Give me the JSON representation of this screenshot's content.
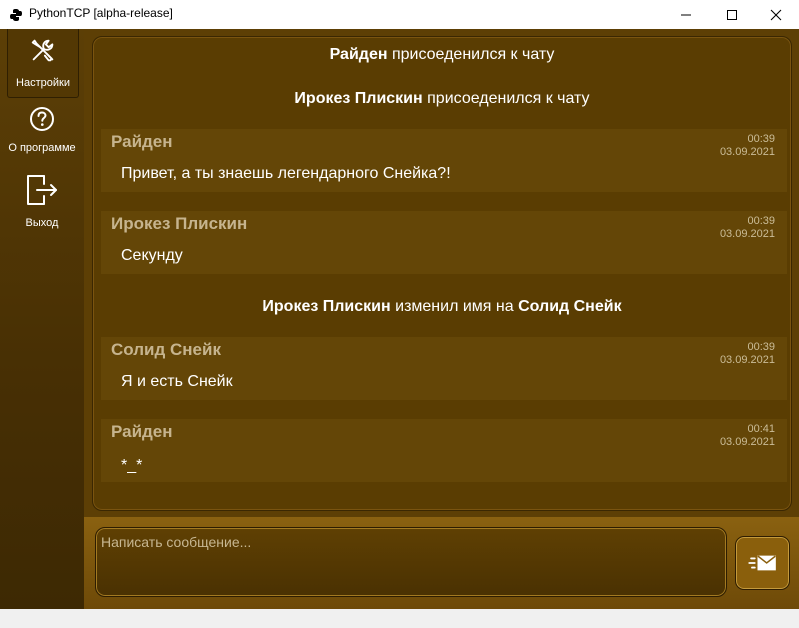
{
  "window": {
    "title": "PythonTCP [alpha-release]",
    "app_icon": "python-icon",
    "controls": [
      "minimize-icon",
      "maximize-icon",
      "close-icon"
    ]
  },
  "sidebar": {
    "items": [
      {
        "label": "Настройки",
        "icon": "wrench-screwdriver-icon",
        "active": true
      },
      {
        "label": "О программе",
        "icon": "question-circle-icon",
        "active": false
      },
      {
        "label": "Выход",
        "icon": "logout-icon",
        "active": false
      }
    ]
  },
  "chat": {
    "events": [
      {
        "kind": "system",
        "name": "Райден",
        "text": "присоеденился к чату"
      },
      {
        "kind": "system",
        "name": "Ирокез Плискин",
        "text": "присоеденился к чату"
      },
      {
        "kind": "message",
        "author": "Райден",
        "time": "00:39",
        "date": "03.09.2021",
        "text": "Привет, а ты знаешь легендарного Снейка?!"
      },
      {
        "kind": "message",
        "author": "Ирокез Плискин",
        "time": "00:39",
        "date": "03.09.2021",
        "text": "Секунду"
      },
      {
        "kind": "system",
        "name": "Ирокез Плискин",
        "text": "изменил имя на",
        "new_name": "Солид Снейк"
      },
      {
        "kind": "message",
        "author": "Солид Снейк",
        "time": "00:39",
        "date": "03.09.2021",
        "text": "Я и есть Снейк"
      },
      {
        "kind": "message",
        "author": "Райден",
        "time": "00:41",
        "date": "03.09.2021",
        "text": "*_*"
      }
    ]
  },
  "composer": {
    "placeholder": "Написать сообщение...",
    "send_icon": "send-mail-icon"
  },
  "colors": {
    "sidebar": "#4a3104",
    "main_bg": "#5d3f05",
    "message_bg": "#644607",
    "author_text": "#c6b48e",
    "accent": "#8a5f0c"
  }
}
